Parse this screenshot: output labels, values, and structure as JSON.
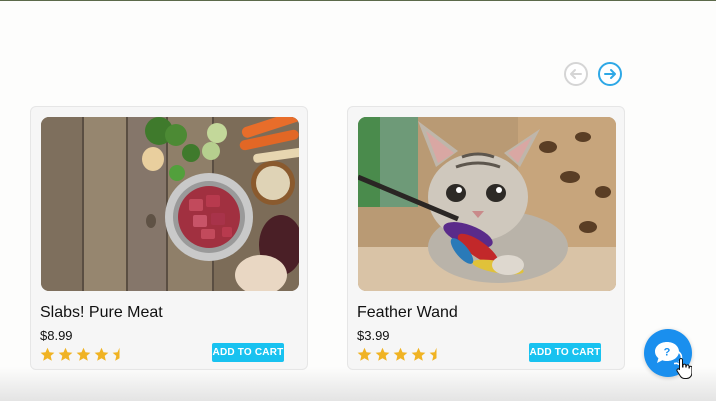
{
  "carousel": {
    "prev_icon": "arrow-left-icon",
    "next_icon": "arrow-right-icon"
  },
  "products": [
    {
      "name": "Slabs! Pure Meat",
      "price": "$8.99",
      "rating": 4.5,
      "cart_label": "ADD TO CART"
    },
    {
      "name": "Feather Wand",
      "price": "$3.99",
      "rating": 4.5,
      "cart_label": "ADD TO CART"
    }
  ],
  "help": {
    "icon": "chat-help-icon"
  },
  "colors": {
    "accent": "#18c2f0",
    "star": "#f0b323",
    "help": "#1a8fee",
    "nav_active": "#2ea8e6"
  }
}
